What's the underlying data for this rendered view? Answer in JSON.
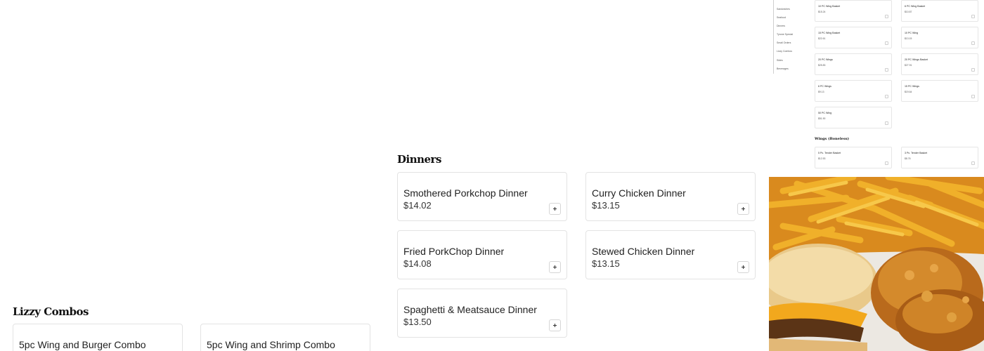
{
  "mini_view": {
    "nav_items": [
      "Sandwiches",
      "Seafood",
      "Dinners",
      "Tyrone Special",
      "Small Orders",
      "Lizzy Combos",
      "Sides",
      "Beverages"
    ],
    "wing_cards": [
      {
        "name": "10 PC Wing Basket",
        "price": "$15.24"
      },
      {
        "name": "6 PC Wing Basket",
        "price": "$10.87"
      },
      {
        "name": "15 PC Wing Basket",
        "price": "$22.61"
      },
      {
        "name": "10 PC Wing",
        "price": "$13.15"
      },
      {
        "name": "20 PC Wings",
        "price": "$25.83"
      },
      {
        "name": "20 PC Wings Basket",
        "price": "$27.91"
      },
      {
        "name": "6 PC Wings",
        "price": "$9.13"
      },
      {
        "name": "15 PC Wings",
        "price": "$19.64"
      },
      {
        "name": "50 PC Wing",
        "price": "$51.90"
      }
    ],
    "boneless_heading": "Wings (Boneless)",
    "boneless_cards": [
      {
        "name": "5 Pc. Tender Basket",
        "price": "$12.53"
      },
      {
        "name": "3 Pc. Tender Basket",
        "price": "$8.76"
      }
    ]
  },
  "dinners": {
    "heading": "Dinners",
    "items": [
      {
        "name": "Smothered Porkchop Dinner",
        "price": "$14.02"
      },
      {
        "name": "Curry Chicken Dinner",
        "price": "$13.15"
      },
      {
        "name": "Fried PorkChop Dinner",
        "price": "$14.08"
      },
      {
        "name": "Stewed Chicken Dinner",
        "price": "$13.15"
      },
      {
        "name": "Spaghetti & Meatsauce Dinner",
        "price": "$13.50"
      }
    ]
  },
  "lizzy_combos": {
    "heading": "Lizzy Combos",
    "items": [
      {
        "name": "5pc Wing and Burger Combo"
      },
      {
        "name": "5pc Wing and Shrimp Combo"
      }
    ]
  },
  "photo": {
    "subject": "fried chicken, fries and cheeseburger"
  },
  "colors": {
    "card_border": "#e3e3e3",
    "text": "#1f1f1f"
  }
}
